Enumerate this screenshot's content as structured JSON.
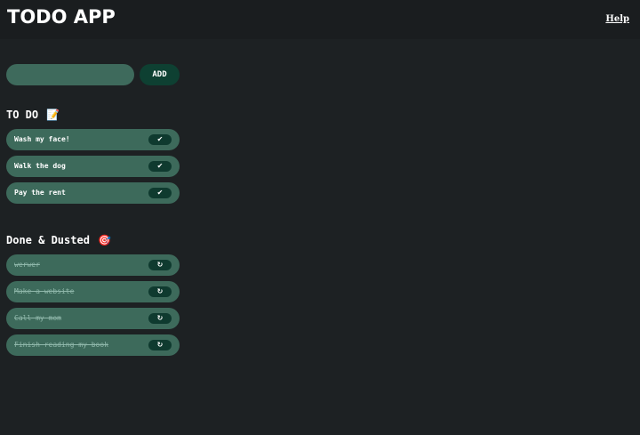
{
  "header": {
    "title": "TODO APP",
    "help_label": "Help"
  },
  "form": {
    "input_value": "",
    "add_label": "ADD"
  },
  "todo": {
    "heading": "TO DO",
    "emoji": "📝",
    "action_icon": "✔",
    "items": [
      {
        "label": "Wash my face!"
      },
      {
        "label": "Walk the dog"
      },
      {
        "label": "Pay the rent"
      }
    ]
  },
  "done": {
    "heading": "Done & Dusted",
    "emoji": "🎯",
    "action_icon": "↻",
    "items": [
      {
        "label": "werwer"
      },
      {
        "label": "Make a website"
      },
      {
        "label": "Call my mom"
      },
      {
        "label": "Finish reading my book"
      }
    ]
  },
  "colors": {
    "background": "#1d2123",
    "item_background": "#3d6a5b",
    "button_background": "#0e4032"
  }
}
